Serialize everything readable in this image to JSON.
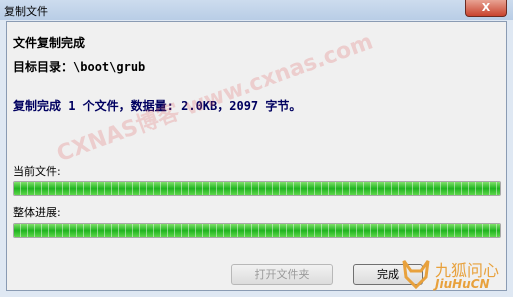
{
  "window": {
    "title": "复制文件",
    "close_glyph": "X"
  },
  "dialog": {
    "heading": "文件复制完成",
    "target_label": "目标目录：",
    "target_path": "\\boot\\grub",
    "summary": "复制完成 1 个文件，数据量: 2.0KB，2097 字节。"
  },
  "progress": {
    "current_file_label": "当前文件:",
    "current_file_fraction": 1.0,
    "overall_label": "整体进展:",
    "overall_fraction": 1.0,
    "color": "#22b522"
  },
  "buttons": {
    "open_folder": "打开文件夹",
    "finish": "完成"
  },
  "watermarks": {
    "blog": "CXNAS博客 www.cxnas.com",
    "brand_cn": "九狐问心",
    "brand_en": "JiuHuCN"
  }
}
